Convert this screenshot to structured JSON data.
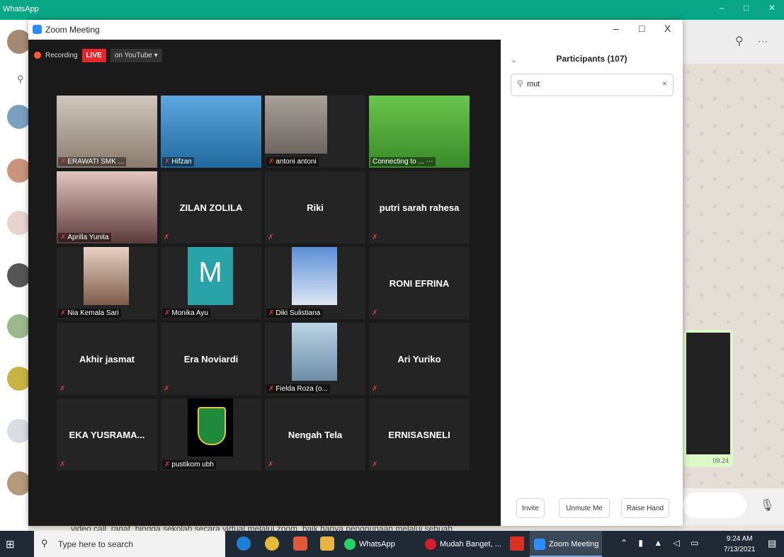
{
  "whatsapp": {
    "title": "WhatsApp",
    "window_buttons": [
      "–",
      "□",
      "✕"
    ],
    "bubble_time": "09.24",
    "bottom_text": "video call, rapat, hingga sekolah secara virtual melalui zoom, baik hanya penggunaan melalui sebuah"
  },
  "zoom": {
    "title": "Zoom Meeting",
    "window_buttons": [
      "–",
      "□",
      "X"
    ],
    "recording_label": "Recording",
    "live_label": "LIVE",
    "youtube_label": "on YouTube ▾",
    "tiles": [
      {
        "label": "ERAWATI SMK ...",
        "big": "",
        "mic": true
      },
      {
        "label": "Hifzan",
        "big": "",
        "mic": true
      },
      {
        "label": "antoni antoni",
        "big": "",
        "mic": true
      },
      {
        "label": "Connecting to ... ⋯",
        "big": "",
        "mic": false
      },
      {
        "label": "Aprilla Yunita",
        "big": "",
        "mic": true
      },
      {
        "label": "",
        "big": "ZILAN ZOLILA",
        "mic": true
      },
      {
        "label": "",
        "big": "Riki",
        "mic": true
      },
      {
        "label": "",
        "big": "putri sarah rahesa",
        "mic": true
      },
      {
        "label": "Nia Kemala Sari",
        "big": "",
        "mic": true
      },
      {
        "label": "Monika Ayu",
        "big": "",
        "mic": true
      },
      {
        "label": "Diki Sulistiana",
        "big": "",
        "mic": true
      },
      {
        "label": "",
        "big": "RONI EFRINA",
        "mic": true
      },
      {
        "label": "",
        "big": "Akhir jasmat",
        "mic": true
      },
      {
        "label": "",
        "big": "Era Noviardi",
        "mic": true
      },
      {
        "label": "Fielda Roza (o...",
        "big": "",
        "mic": true
      },
      {
        "label": "",
        "big": "Ari Yuriko",
        "mic": true
      },
      {
        "label": "",
        "big": "EKA YUSRAMA...",
        "mic": true
      },
      {
        "label": "pustikom ubh",
        "big": "",
        "mic": true
      },
      {
        "label": "",
        "big": "Nengah Tela",
        "mic": true
      },
      {
        "label": "",
        "big": "ERNISASNELI",
        "mic": true
      }
    ],
    "monika_initial": "M",
    "participants": {
      "title": "Participants (107)",
      "search_value": "mut",
      "invite_label": "Invite",
      "unmute_label": "Unmute Me",
      "raise_hand_label": "Raise Hand"
    }
  },
  "taskbar": {
    "search_placeholder": "Type here to search",
    "tasks": [
      "WhatsApp",
      "Mudah Banget, ...",
      "Zoom Meeting"
    ],
    "time": "9:24 AM",
    "date": "7/13/2021"
  },
  "colors": {
    "whatsapp_green": "#09a786",
    "zoom_blue": "#2d8cff",
    "live_red": "#e4262d",
    "taskbar": "#1f2a36"
  }
}
